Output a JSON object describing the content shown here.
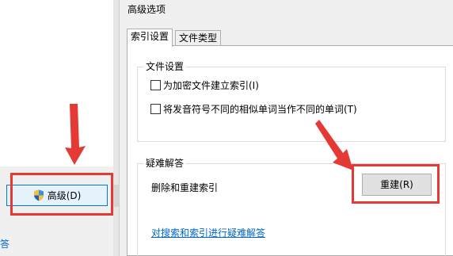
{
  "left_panel": {
    "advanced_button_label": "高级(D)",
    "link_fragment": "答"
  },
  "dialog": {
    "title": "高级选项",
    "tabs": [
      {
        "label": "索引设置",
        "active": true
      },
      {
        "label": "文件类型",
        "active": false
      }
    ],
    "file_settings": {
      "group_label": "文件设置",
      "options": [
        {
          "label": "为加密文件建立索引(I)",
          "checked": false
        },
        {
          "label": "将发音符号不同的相似单词当作不同的单词(T)",
          "checked": false
        }
      ]
    },
    "troubleshooting": {
      "group_label": "疑难解答",
      "delete_rebuild_label": "删除和重建索引",
      "rebuild_button_label": "重建(R)",
      "troubleshoot_link": "对搜索和索引进行疑难解答"
    }
  },
  "annotations": {
    "highlight_color": "#e53935",
    "shield_icon": "uac-shield-icon"
  }
}
